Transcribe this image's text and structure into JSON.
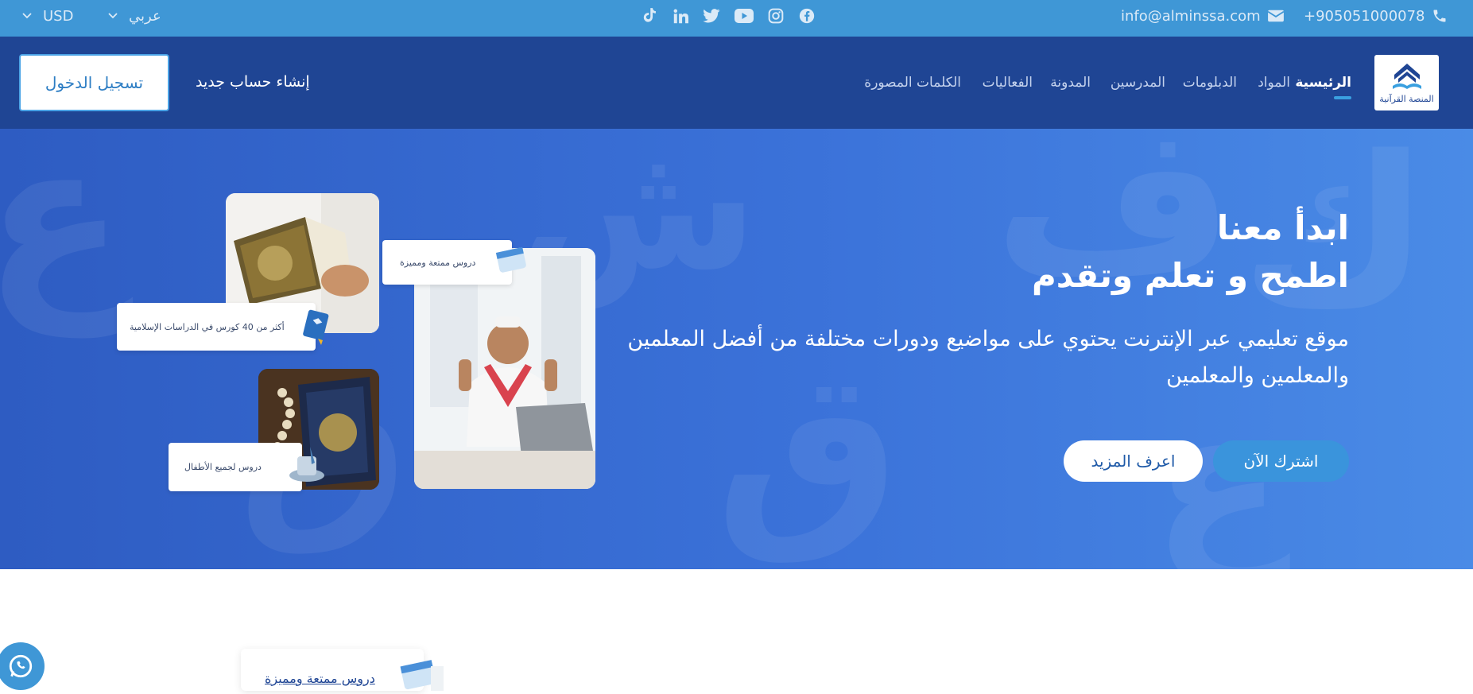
{
  "topbar": {
    "phone": "+905051000078",
    "email": "info@alminssa.com",
    "language": "عربي",
    "currency": "USD",
    "social_icons": [
      "facebook-icon",
      "instagram-icon",
      "youtube-icon",
      "twitter-icon",
      "linkedin-icon",
      "tiktok-icon"
    ]
  },
  "navbar": {
    "logo_text": "المنصة القرآنية",
    "items": [
      "الرئيسية",
      "المواد",
      "الدبلومات",
      "المدرسين",
      "المدونة",
      "الفعاليات",
      "الكلمات المصورة"
    ],
    "signup_label": "إنشاء حساب جديد",
    "login_label": "تسجيل الدخول"
  },
  "hero": {
    "title_line1": "ابدأ معنا",
    "title_line2": "اطمح و تعلم وتقدم",
    "description": "موقع تعليمي عبر الإنترنت يحتوي على مواضيع ودورات مختلفة من أفضل المعلمين والمعلمين والمعلمين",
    "subscribe_label": "اشترك الآن",
    "learn_more_label": "اعرف المزيد",
    "cards": {
      "lessons": "دروس ممتعة ومميزة",
      "courses": "أكثر من  40 كورس في الدراسات الإسلامية",
      "kids": "دروس لجميع الأطفال"
    }
  },
  "below": {
    "card_text": "دروس ممتعة ومميزة"
  },
  "colors": {
    "topbar": "#3f97d6",
    "navbar": "#1f4594",
    "accent": "#3a94dc"
  }
}
